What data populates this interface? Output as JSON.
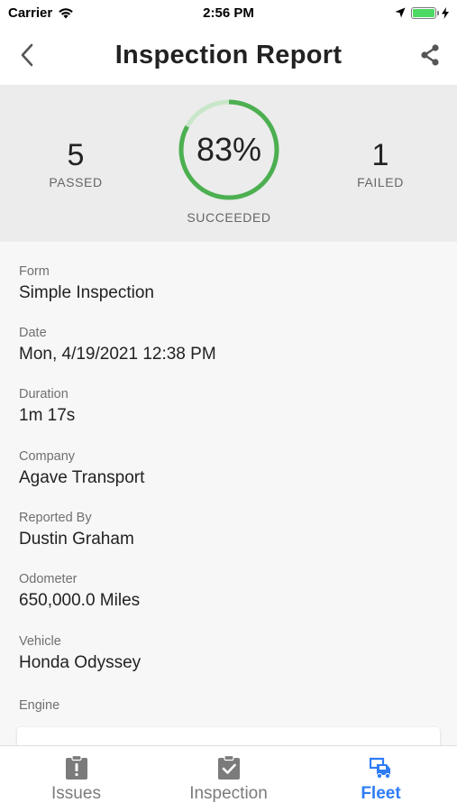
{
  "status_bar": {
    "carrier": "Carrier",
    "time": "2:56 PM",
    "battery_level": 1.0
  },
  "nav": {
    "title": "Inspection Report",
    "back_icon": "chevron-left-icon",
    "share_icon": "share-icon"
  },
  "summary": {
    "passed_count": "5",
    "passed_label": "PASSED",
    "percent_text": "83%",
    "percent_value": 0.83,
    "succeeded_label": "SUCCEEDED",
    "failed_count": "1",
    "failed_label": "FAILED",
    "colors": {
      "success": "#4caf50",
      "track": "#c8e6c9"
    }
  },
  "fields": [
    {
      "label": "Form",
      "value": "Simple Inspection"
    },
    {
      "label": "Date",
      "value": "Mon, 4/19/2021 12:38 PM"
    },
    {
      "label": "Duration",
      "value": "1m 17s"
    },
    {
      "label": "Company",
      "value": "Agave Transport"
    },
    {
      "label": "Reported By",
      "value": "Dustin Graham"
    },
    {
      "label": "Odometer",
      "value": "650,000.0 Miles"
    },
    {
      "label": "Vehicle",
      "value": "Honda Odyssey"
    },
    {
      "label": "Engine",
      "value": ""
    }
  ],
  "tabs": [
    {
      "label": "Issues",
      "icon": "clipboard-alert-icon",
      "active": false
    },
    {
      "label": "Inspection",
      "icon": "clipboard-check-icon",
      "active": false
    },
    {
      "label": "Fleet",
      "icon": "fleet-icon",
      "active": true
    }
  ],
  "colors": {
    "accent": "#2e7cf6",
    "inactive": "#7b7b7b"
  }
}
